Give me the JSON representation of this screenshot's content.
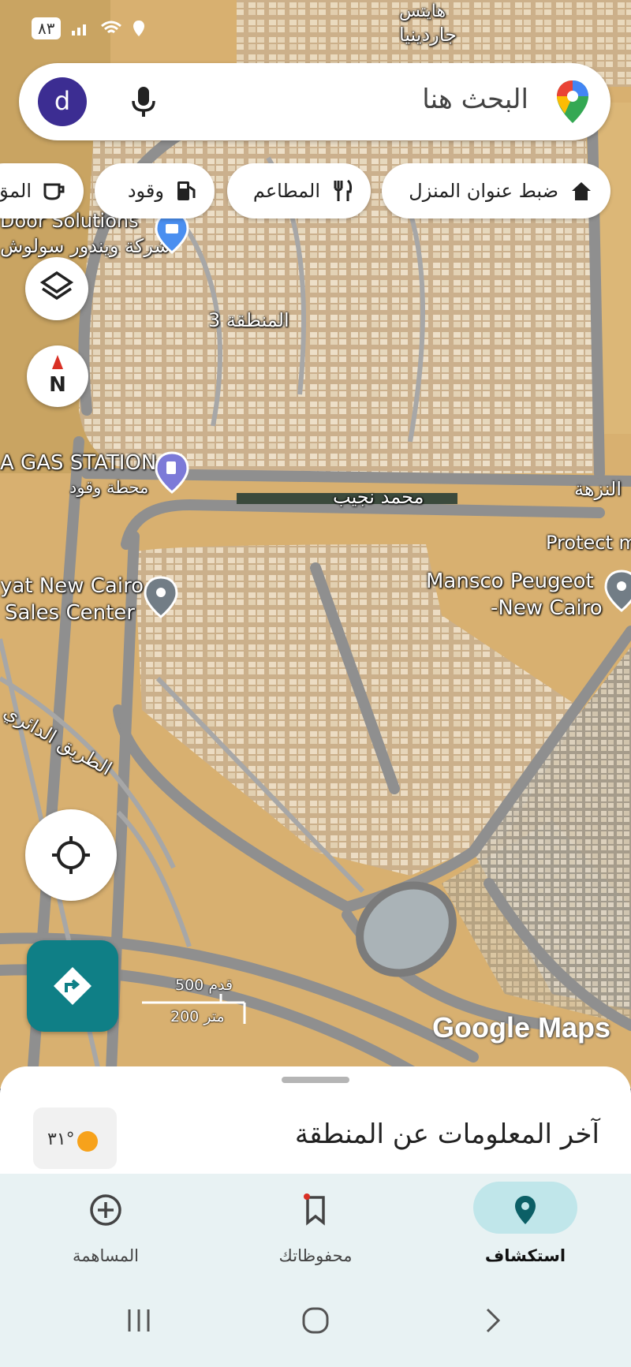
{
  "status_bar": {
    "battery": "٨٣"
  },
  "search": {
    "placeholder": "البحث هنا",
    "avatar_letter": "d"
  },
  "chips": [
    {
      "label": "ضبط عنوان المنزل",
      "icon": "home-icon"
    },
    {
      "label": "المطاعم",
      "icon": "restaurant-icon"
    },
    {
      "label": "وقود",
      "icon": "gas-icon"
    },
    {
      "label": "المق",
      "icon": "coffee-icon"
    }
  ],
  "map_labels": {
    "top_district": "جاردينيا",
    "top_district_2": "هايتس",
    "windows_en": "Door Solutions",
    "windows_ar": "شركة ويندور سولوش",
    "zone": "المنطقة 3",
    "gas_station_en": "A GAS STATION",
    "gas_station_ar": "محطة وقود",
    "street_naguib": "محمد نجيب",
    "street_nozha": "النزهة",
    "protect": "Protect m",
    "sales_center_1": "yat New Cairo",
    "sales_center_2": "Sales Center",
    "mansco_1": "Mansco Peugeot",
    "mansco_2": "-New Cairo",
    "ring_road": "الطريق الدائري"
  },
  "scale": {
    "feet": "500 قدم",
    "meters": "200 متر"
  },
  "google_logo": "Google Maps",
  "sheet": {
    "title": "آخر المعلومات عن المنطقة",
    "temperature": "٣١°"
  },
  "nav": [
    {
      "label": "استكشاف",
      "icon": "explore-pin-icon",
      "active": true
    },
    {
      "label": "محفوظاتك",
      "icon": "bookmark-icon",
      "active": false
    },
    {
      "label": "المساهمة",
      "icon": "add-circle-icon",
      "active": false
    }
  ],
  "colors": {
    "map_sand": "#d8b070",
    "road": "#8f8f8f",
    "accent_teal": "#0f7f86",
    "avatar": "#3c2d92",
    "nav_bg": "#e8f2f3"
  }
}
